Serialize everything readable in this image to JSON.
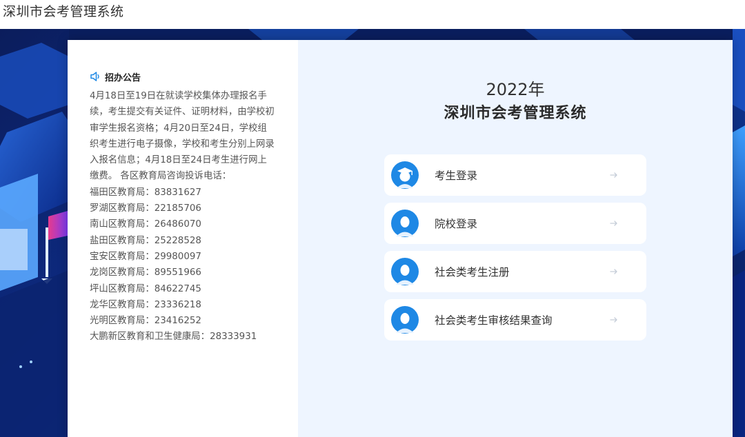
{
  "header": {
    "site_title": "深圳市会考管理系统"
  },
  "notice": {
    "title": "招办公告",
    "intro": "4月18日至19日在就读学校集体办理报名手续，考生提交有关证件、证明材料，由学校初审学生报名资格；4月20日至24日，学校组织考生进行电子摄像，学校和考生分别上网录入报名信息；4月18日至24日考生进行网上缴费。 各区教育局咨询投诉电话：",
    "phones": [
      "福田区教育局：83831627",
      "罗湖区教育局：22185706",
      "南山区教育局：26486070",
      "盐田区教育局：25228528",
      "宝安区教育局：29980097",
      "龙岗区教育局：89551966",
      "坪山区教育局：84622745",
      "龙华区教育局：23336218",
      "光明区教育局：23416252",
      "大鹏新区教育和卫生健康局：28333931"
    ]
  },
  "system": {
    "year": "2022年",
    "title": "深圳市会考管理系统"
  },
  "login_options": [
    {
      "label": "考生登录",
      "icon": "graduate-avatar-icon"
    },
    {
      "label": "院校登录",
      "icon": "person-avatar-icon"
    },
    {
      "label": "社会类考生注册",
      "icon": "person-avatar-icon"
    },
    {
      "label": "社会类考生审核结果查询",
      "icon": "person-avatar-icon"
    }
  ],
  "colors": {
    "accent": "#1e88e5",
    "panel_bg": "#eef5ff",
    "background": "#0d2a80"
  }
}
